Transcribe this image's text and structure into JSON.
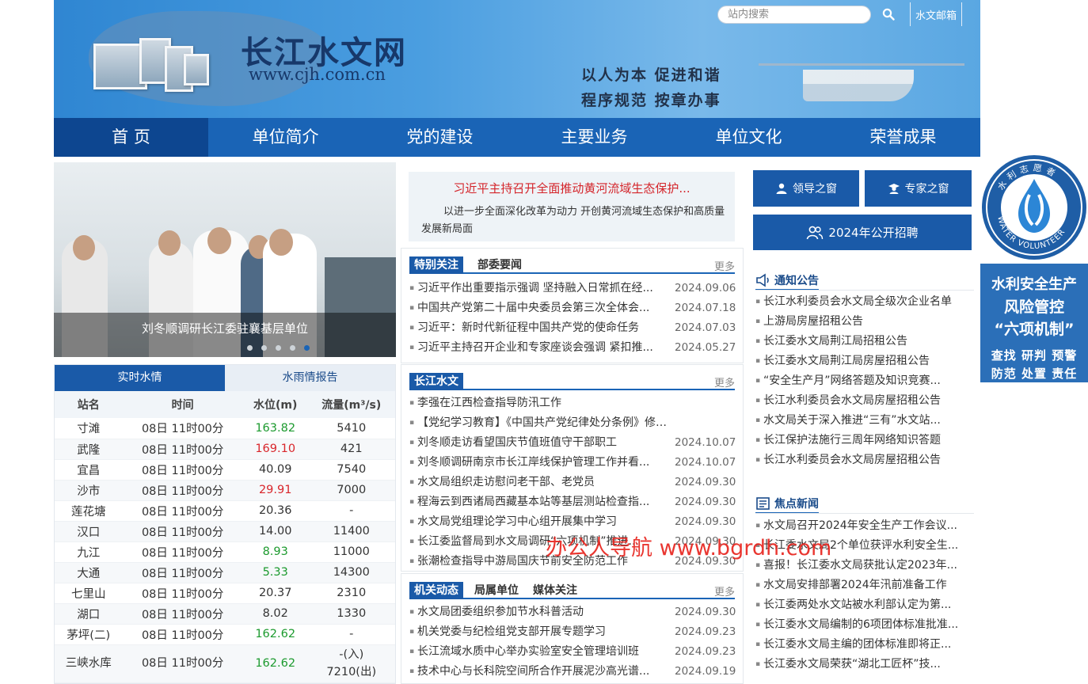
{
  "header": {
    "site_name": "长江水文网",
    "site_domain": "www.cjh.com.cn",
    "slogan_line1": "以人为本  促进和谐",
    "slogan_line2": "程序规范  按章办事",
    "search_placeholder": "站内搜索",
    "mail_label": "水文邮箱",
    "search_icon": "search-icon"
  },
  "nav": {
    "items": [
      "首 页",
      "单位简介",
      "党的建设",
      "主要业务",
      "单位文化",
      "荣誉成果"
    ]
  },
  "carousel": {
    "caption": "刘冬顺调研长江委驻襄基层单位",
    "slide_count": 5,
    "active_slide": 5
  },
  "water": {
    "tabs": [
      "实时水情",
      "水雨情报告"
    ],
    "headers": [
      "站名",
      "时间",
      "水位(m)",
      "流量(m³/s)"
    ],
    "rows": [
      {
        "station": "寸滩",
        "time": "08日 11时00分",
        "level": "163.82",
        "flow": "5410",
        "trend": "down"
      },
      {
        "station": "武隆",
        "time": "08日 11时00分",
        "level": "169.10",
        "flow": "421",
        "trend": "up"
      },
      {
        "station": "宜昌",
        "time": "08日 11时00分",
        "level": "40.09",
        "flow": "7540",
        "trend": "none"
      },
      {
        "station": "沙市",
        "time": "08日 11时00分",
        "level": "29.91",
        "flow": "7000",
        "trend": "up"
      },
      {
        "station": "莲花塘",
        "time": "08日 11时00分",
        "level": "20.36",
        "flow": "-",
        "trend": "none"
      },
      {
        "station": "汉口",
        "time": "08日 11时00分",
        "level": "14.00",
        "flow": "11400",
        "trend": "none"
      },
      {
        "station": "九江",
        "time": "08日 11时00分",
        "level": "8.93",
        "flow": "11000",
        "trend": "down"
      },
      {
        "station": "大通",
        "time": "08日 11时00分",
        "level": "5.33",
        "flow": "14300",
        "trend": "down"
      },
      {
        "station": "七里山",
        "time": "08日 11时00分",
        "level": "20.37",
        "flow": "2310",
        "trend": "none"
      },
      {
        "station": "湖口",
        "time": "08日 11时00分",
        "level": "8.02",
        "flow": "1330",
        "trend": "none"
      },
      {
        "station": "茅坪(二)",
        "time": "08日 11时00分",
        "level": "162.62",
        "flow": "-",
        "trend": "down"
      },
      {
        "station": "三峡水库",
        "time": "08日 11时00分",
        "level": "162.62",
        "flow": "-(入)",
        "flow2": "7210(出)",
        "trend": "down"
      }
    ]
  },
  "headline": {
    "title": "习近平主持召开全面推动黄河流域生态保护...",
    "desc": "以进一步全面深化改革为动力 开创黄河流域生态保护和高质量发展新局面"
  },
  "special": {
    "tabs": [
      "特别关注",
      "部委要闻"
    ],
    "more": "更多",
    "items": [
      {
        "title": "习近平作出重要指示强调 坚持融入日常抓在经...",
        "date": "2024.09.06"
      },
      {
        "title": "中国共产党第二十届中央委员会第三次全体会...",
        "date": "2024.07.18"
      },
      {
        "title": "习近平：新时代新征程中国共产党的使命任务",
        "date": "2024.07.03"
      },
      {
        "title": "习近平主持召开企业和专家座谈会强调 紧扣推...",
        "date": "2024.05.27"
      }
    ]
  },
  "cjsw": {
    "tabs": [
      "长江水文"
    ],
    "more": "更多",
    "items": [
      {
        "title": "李强在江西检查指导防汛工作",
        "date": ""
      },
      {
        "title": "【党纪学习教育】《中国共产党纪律处分条例》修订条文...",
        "date": ""
      },
      {
        "title": "刘冬顺走访看望国庆节值班值守干部职工",
        "date": "2024.10.07"
      },
      {
        "title": "刘冬顺调研南京市长江岸线保护管理工作并看...",
        "date": "2024.10.07"
      },
      {
        "title": "水文局组织走访慰问老干部、老党员",
        "date": "2024.09.30"
      },
      {
        "title": "程海云到西诸局西藏基本站等基层测站检查指...",
        "date": "2024.09.30"
      },
      {
        "title": "水文局党组理论学习中心组开展集中学习",
        "date": "2024.09.30"
      },
      {
        "title": "长江委监督局到水文局调研“六项机制”推进...",
        "date": "2024.09.30"
      },
      {
        "title": "张潮检查指导中游局国庆节前安全防范工作",
        "date": "2024.09.30"
      }
    ]
  },
  "jgdt": {
    "tabs": [
      "机关动态",
      "局属单位",
      "媒体关注"
    ],
    "more": "更多",
    "items": [
      {
        "title": "水文局团委组织参加节水科普活动",
        "date": "2024.09.30"
      },
      {
        "title": "机关党委与纪检组党支部开展专题学习",
        "date": "2024.09.23"
      },
      {
        "title": "长江流域水质中心举办实验室安全管理培训班",
        "date": "2024.09.23"
      },
      {
        "title": "技术中心与长科院空间所合作开展泥沙高光谱...",
        "date": "2024.09.19"
      },
      {
        "title": "技术中心与长江委网络中心合办科普活动...",
        "date": "2024.09.19"
      }
    ]
  },
  "right": {
    "leader_btn": "领导之窗",
    "expert_btn": "专家之窗",
    "recruit_btn": "2024年公开招聘",
    "notice_title": "通知公告",
    "notices": [
      "长江水利委员会水文局全级次企业名单",
      "上游局房屋招租公告",
      "长江委水文局荆江局招租公告",
      "长江委水文局荆江局房屋招租公告",
      "“安全生产月”网络答题及知识竞赛...",
      "长江水利委员会水文局房屋招租公告",
      "水文局关于深入推进“三有”水文站...",
      "长江保护法施行三周年网络知识答题",
      "长江水利委员会水文局房屋招租公告"
    ],
    "focus_title": "焦点新闻",
    "focus": [
      "水文局召开2024年安全生产工作会议...",
      "长江委水文局2个单位获评水利安全生...",
      "喜报！长江委水文局获批认定2023年...",
      "水文局安排部署2024年汛前准备工作",
      "长江委两处水文站被水利部认定为第...",
      "长江委水文局编制的6项团体标准批准...",
      "长江委水文局主编的团体标准即将正...",
      "长江委水文局荣获“湖北工匠杯”技..."
    ]
  },
  "badges": {
    "volunteer_top": "水利志愿者",
    "volunteer_bottom": "WATER VOLUNTEER",
    "safety_l1": "水利安全生产",
    "safety_l2": "风险管控",
    "safety_l3": "“六项机制”",
    "safety_l4": "查找 研判 预警",
    "safety_l5": "防范 处置 责任"
  },
  "watermark": "办公人导航 www.bgrdh.com",
  "colors": {
    "nav": "#1a64b6",
    "nav_active": "#0d4690",
    "rise": "#d9262b",
    "fall": "#1c9a2e"
  }
}
